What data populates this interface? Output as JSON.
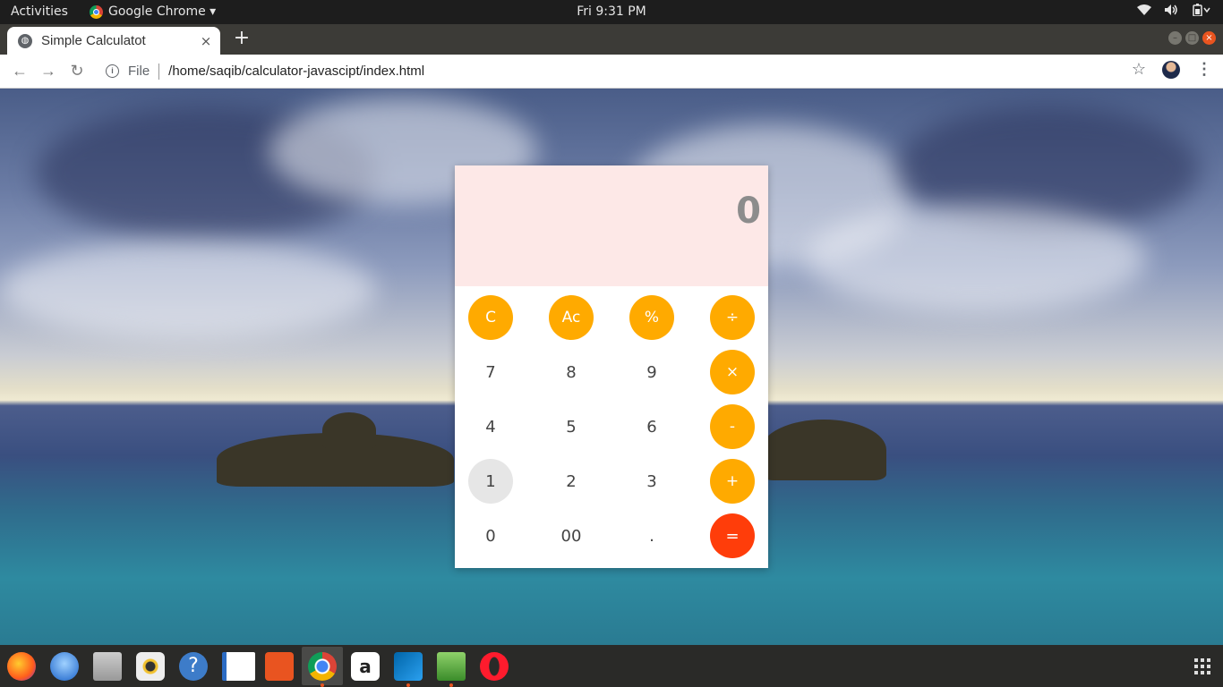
{
  "topbar": {
    "activities": "Activities",
    "app_menu": "Google Chrome ▾",
    "clock": "Fri  9:31 PM",
    "system_icons": [
      "wifi-icon",
      "volume-icon",
      "battery-icon"
    ]
  },
  "browser": {
    "tab_title": "Simple Calculatot",
    "new_tab": "+",
    "close_tab": "×",
    "scheme_label": "File",
    "url": "/home/saqib/calculator-javascipt/index.html"
  },
  "calculator": {
    "display_value": "0",
    "keys": [
      [
        "C",
        "Ac",
        "%",
        "÷"
      ],
      [
        "7",
        "8",
        "9",
        "×"
      ],
      [
        "4",
        "5",
        "6",
        "-"
      ],
      [
        "1",
        "2",
        "3",
        "+"
      ],
      [
        "0",
        "00",
        ".",
        "="
      ]
    ],
    "colors": {
      "operator": "#ffaa00",
      "equals": "#ff3d0a",
      "display_bg": "#fde8e7"
    }
  },
  "dock": {
    "apps": [
      "firefox-icon",
      "thunderbird-icon",
      "files-icon",
      "rhythmbox-icon",
      "help-icon",
      "writer-icon",
      "software-icon",
      "chrome-icon",
      "amazon-icon",
      "vscode-icon",
      "image-viewer-icon",
      "opera-icon"
    ],
    "show_apps": "show-applications-icon"
  }
}
